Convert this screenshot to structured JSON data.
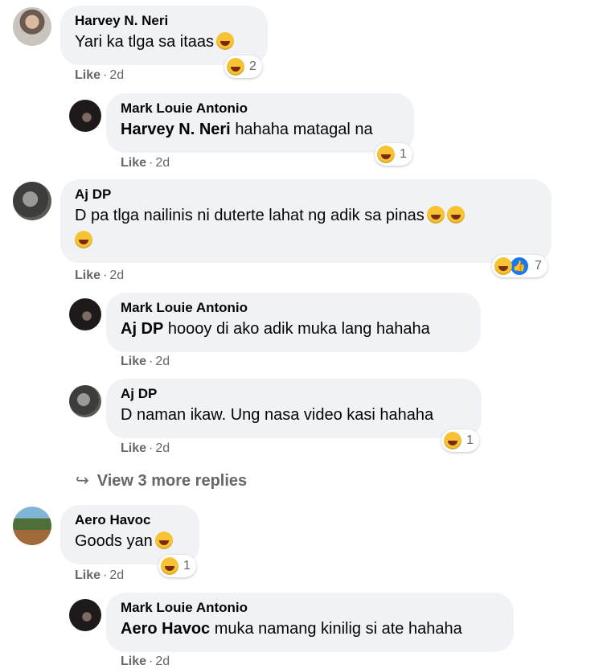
{
  "comments": [
    {
      "author": "Harvey N. Neri",
      "text": "Yari ka tlga sa itaas",
      "like_label": "Like",
      "time": "2d",
      "reaction_count": "2",
      "avatar": "harvey-avatar"
    },
    {
      "author": "Mark Louie Antonio",
      "mention": "Harvey N. Neri",
      "text": "hahaha matagal na",
      "like_label": "Like",
      "time": "2d",
      "reaction_count": "1",
      "avatar": "mark-avatar"
    },
    {
      "author": "Aj DP",
      "text": "D pa tlga nailinis ni duterte lahat ng adik sa pinas",
      "like_label": "Like",
      "time": "2d",
      "reaction_count": "7",
      "avatar": "aj-avatar"
    },
    {
      "author": "Mark Louie Antonio",
      "mention": "Aj DP",
      "text": "hoooy di ako adik muka lang hahaha",
      "like_label": "Like",
      "time": "2d",
      "avatar": "mark-avatar"
    },
    {
      "author": "Aj DP",
      "text": "D naman ikaw. Ung nasa video kasi hahaha",
      "like_label": "Like",
      "time": "2d",
      "reaction_count": "1",
      "avatar": "aj-avatar"
    },
    {
      "author": "Aero Havoc",
      "text": "Goods yan",
      "like_label": "Like",
      "time": "2d",
      "reaction_count": "1",
      "avatar": "aero-avatar"
    },
    {
      "author": "Mark Louie Antonio",
      "mention": "Aero Havoc",
      "text": "muka namang kinilig si ate hahaha",
      "like_label": "Like",
      "time": "2d",
      "avatar": "mark-avatar"
    }
  ],
  "view_more": {
    "arrow": "↪",
    "label": "View 3 more replies"
  },
  "ui": {
    "dot": "·"
  }
}
